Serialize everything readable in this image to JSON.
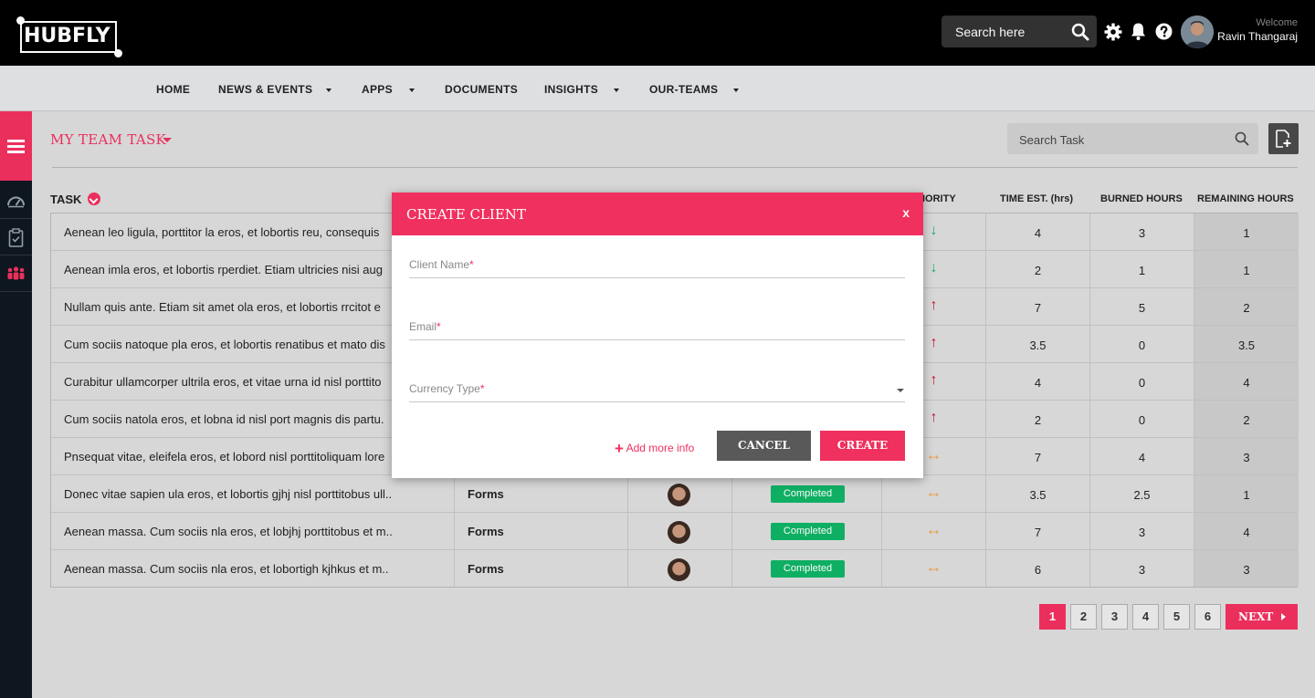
{
  "brand": {
    "logo_text": "HUBFLY"
  },
  "header": {
    "search_placeholder": "Search here",
    "welcome": "Welcome",
    "user_name": "Ravin Thangaraj"
  },
  "nav": {
    "items": [
      {
        "label": "HOME",
        "has_dropdown": false
      },
      {
        "label": "NEWS & EVENTS",
        "has_dropdown": true
      },
      {
        "label": "APPS",
        "has_dropdown": true
      },
      {
        "label": "DOCUMENTS",
        "has_dropdown": false
      },
      {
        "label": "INSIGHTS",
        "has_dropdown": true
      },
      {
        "label": "OUR-TEAMS",
        "has_dropdown": true
      }
    ]
  },
  "sidebar": {
    "items": [
      {
        "icon": "menu-icon"
      },
      {
        "icon": "dashboard-icon"
      },
      {
        "icon": "clipboard-icon"
      },
      {
        "icon": "team-icon"
      }
    ]
  },
  "page": {
    "title": "MY TEAM TASK",
    "search_placeholder": "Search Task"
  },
  "table": {
    "headers": {
      "task": "TASK",
      "priority": "IORITY",
      "est": "TIME EST. (hrs)",
      "burned": "BURNED HOURS",
      "remaining": "REMAINING HOURS"
    },
    "rows": [
      {
        "task": "Aenean leo ligula, porttitor la eros, et lobortis reu, consequis",
        "project": "",
        "status": "",
        "priority": "low",
        "priority_glyph": "↓",
        "est": "4",
        "burned": "3",
        "remaining": "1"
      },
      {
        "task": "Aenean imla eros, et lobortis rperdiet. Etiam ultricies nisi aug",
        "project": "",
        "status": "",
        "priority": "low",
        "priority_glyph": "↓",
        "est": "2",
        "burned": "1",
        "remaining": "1"
      },
      {
        "task": "Nullam quis ante. Etiam sit amet ola eros, et lobortis rrcitot e",
        "project": "",
        "status": "",
        "priority": "high",
        "priority_glyph": "↑",
        "est": "7",
        "burned": "5",
        "remaining": "2"
      },
      {
        "task": "Cum sociis natoque pla eros, et lobortis renatibus et mato dis",
        "project": "",
        "status": "",
        "priority": "high",
        "priority_glyph": "↑",
        "est": "3.5",
        "burned": "0",
        "remaining": "3.5"
      },
      {
        "task": "Curabitur ullamcorper ultrila eros, et vitae urna id nisl porttito",
        "project": "",
        "status": "",
        "priority": "high",
        "priority_glyph": "↑",
        "est": "4",
        "burned": "0",
        "remaining": "4"
      },
      {
        "task": "Cum sociis natola eros, et lobna id nisl port magnis dis partu.",
        "project": "",
        "status": "",
        "priority": "high",
        "priority_glyph": "↑",
        "est": "2",
        "burned": "0",
        "remaining": "2"
      },
      {
        "task": "Pnsequat vitae, eleifela eros, et lobord nisl porttitoliquam lore",
        "project": "",
        "status": "",
        "priority": "medium",
        "priority_glyph": "↔",
        "est": "7",
        "burned": "4",
        "remaining": "3"
      },
      {
        "task": "Donec vitae sapien ula eros, et lobortis gjhj nisl porttitobus ull..",
        "project": "Forms",
        "status": "Completed",
        "priority": "medium",
        "priority_glyph": "↔",
        "est": "3.5",
        "burned": "2.5",
        "remaining": "1"
      },
      {
        "task": "Aenean massa. Cum sociis nla eros, et lobjhj porttitobus et m..",
        "project": "Forms",
        "status": "Completed",
        "priority": "medium",
        "priority_glyph": "↔",
        "est": "7",
        "burned": "3",
        "remaining": "4"
      },
      {
        "task": "Aenean massa. Cum sociis nla eros, et lobortigh kjhkus et m..",
        "project": "Forms",
        "status": "Completed",
        "priority": "medium",
        "priority_glyph": "↔",
        "est": "6",
        "burned": "3",
        "remaining": "3"
      }
    ]
  },
  "pagination": {
    "pages": [
      "1",
      "2",
      "3",
      "4",
      "5",
      "6"
    ],
    "active": "1",
    "next": "NEXT"
  },
  "modal": {
    "title": "CREATE CLIENT",
    "close": "x",
    "fields": {
      "client_name": "Client Name",
      "email": "Email",
      "currency": "Currency Type",
      "required_mark": "*"
    },
    "add_more": "Add more info",
    "add_more_glyph": "+",
    "cancel": "CANCEL",
    "create": "CREATE"
  },
  "colors": {
    "accent": "#f0305e",
    "completed": "#10b365",
    "priority_low": "#18b26a",
    "priority_high": "#c8102e",
    "priority_medium": "#f0a040"
  }
}
